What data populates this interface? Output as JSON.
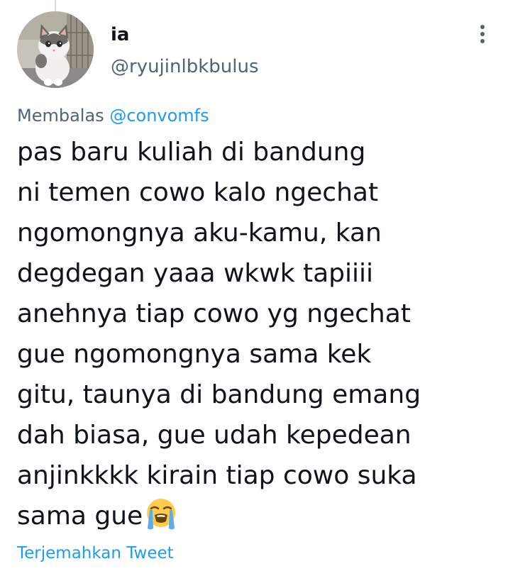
{
  "tweet": {
    "author": {
      "display_name": "ia",
      "handle": "@ryujinlbkbulus",
      "avatar": "kitten-avatar"
    },
    "reply": {
      "prefix": "Membalas",
      "mention": "@convomfs"
    },
    "text_lines": [
      "pas baru kuliah di bandung",
      "ni temen cowo kalo ngechat",
      "ngomongnya aku-kamu, kan",
      "degdegan yaaa wkwk tapiiii",
      "anehnya tiap cowo yg ngechat",
      "gue ngomongnya sama kek",
      "gitu, taunya di bandung emang",
      "dah biasa, gue udah kepedean",
      "anjinkkkk kirain tiap cowo suka",
      "sama gue"
    ],
    "emoji": "loudly-crying-face",
    "translate_label": "Terjemahkan Tweet",
    "more_icon": "more-vertical-icon"
  },
  "colors": {
    "text": "#0f1419",
    "secondary": "#536471",
    "link": "#1d9bf0"
  }
}
